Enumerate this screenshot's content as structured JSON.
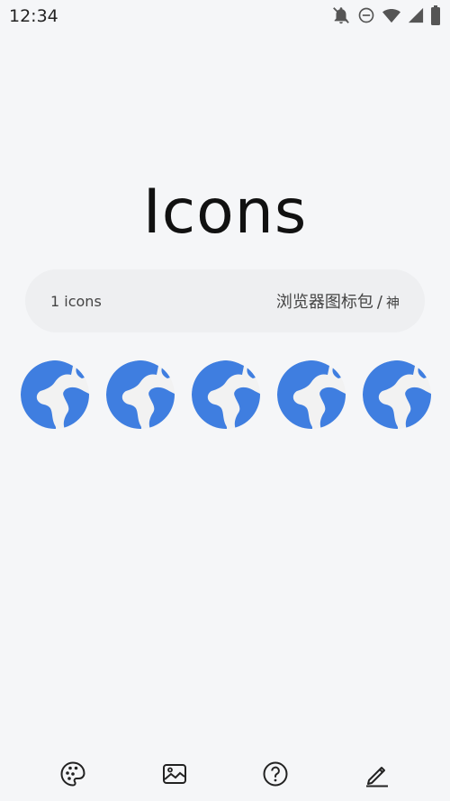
{
  "status_bar": {
    "time": "12:34",
    "icons": [
      "notifications-off-icon",
      "do-not-disturb-icon",
      "wifi-icon",
      "cellular-signal-icon",
      "battery-icon"
    ]
  },
  "title": "Icons",
  "pack": {
    "count_label": "1 icons",
    "name": "浏览器图标包",
    "separator": "/",
    "author": "神"
  },
  "icons": [
    {
      "name": "globe-browser-icon"
    },
    {
      "name": "globe-browser-icon"
    },
    {
      "name": "globe-browser-icon"
    },
    {
      "name": "globe-browser-icon"
    },
    {
      "name": "globe-browser-icon"
    }
  ],
  "bottom_nav": [
    "palette-icon",
    "wallpaper-icon",
    "help-icon",
    "edit-icon"
  ],
  "colors": {
    "background": "#f5f6f8",
    "globe_blue": "#3f7ee0",
    "land_white": "#f2f2f2"
  }
}
